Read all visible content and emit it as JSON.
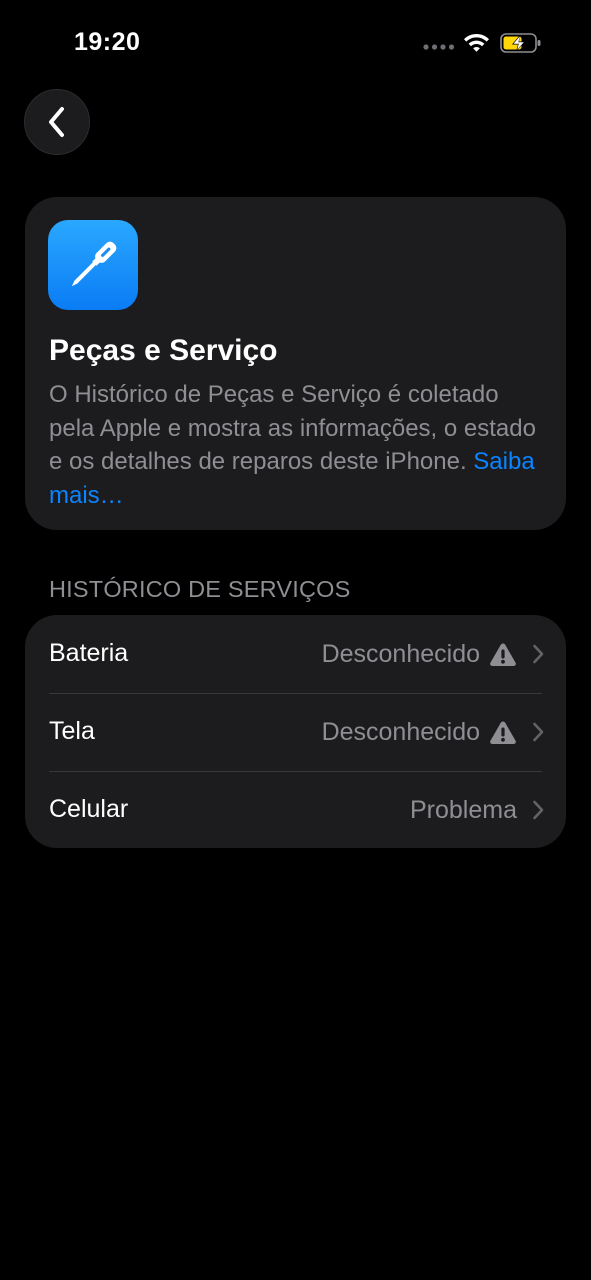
{
  "status_bar": {
    "time": "19:20"
  },
  "nav": {
    "back_icon": "chevron-left-icon"
  },
  "header_card": {
    "icon": "screwdriver-icon",
    "title": "Peças e Serviço",
    "description": "O Histórico de Peças e Serviço é coletado pela Apple e mostra as informações, o estado e os detalhes de reparos deste iPhone.",
    "link_text": "Saiba mais…"
  },
  "services": {
    "section_title": "HISTÓRICO DE SERVIÇOS",
    "rows": [
      {
        "label": "Bateria",
        "value": "Desconhecido",
        "warning": true
      },
      {
        "label": "Tela",
        "value": "Desconhecido",
        "warning": true
      },
      {
        "label": "Celular",
        "value": "Problema",
        "warning": false
      }
    ]
  },
  "colors": {
    "background": "#000000",
    "card": "#1c1c1e",
    "secondary_text": "#8e8e93",
    "link": "#0a84ff",
    "icon_blue": "#0a7cf5",
    "battery_charging": "#ffd60a"
  }
}
